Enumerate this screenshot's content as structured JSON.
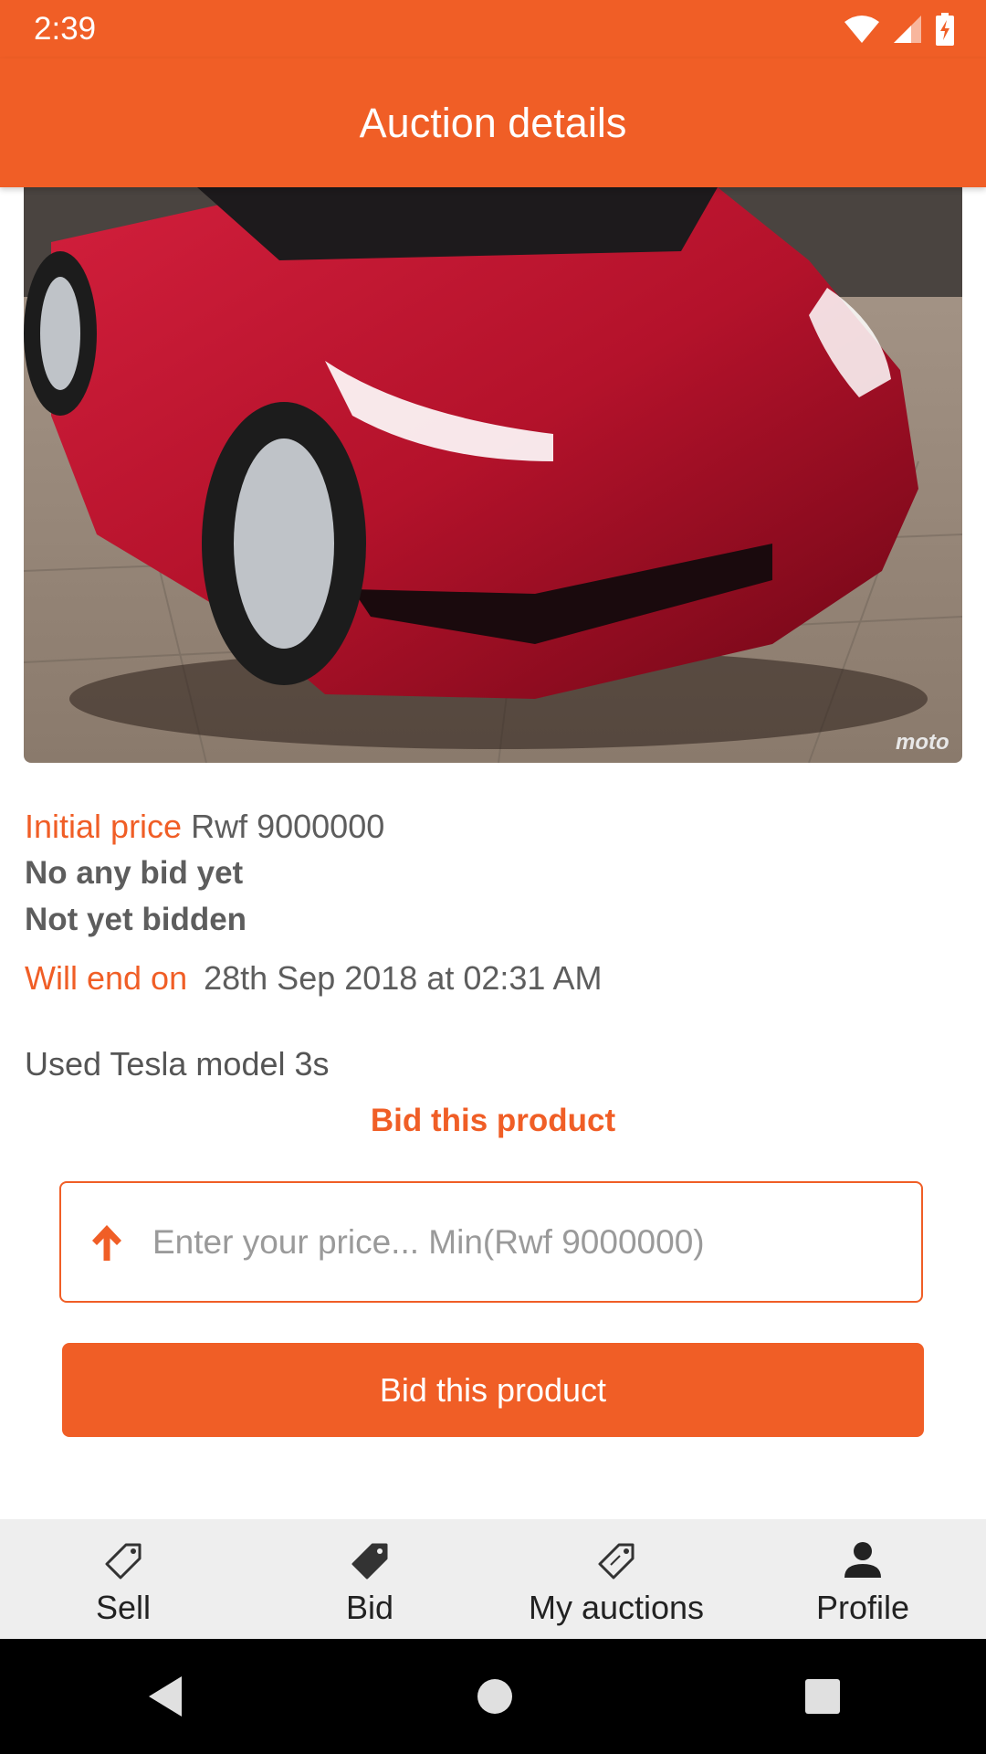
{
  "status_bar": {
    "time": "2:39"
  },
  "app_bar": {
    "title": "Auction details"
  },
  "product": {
    "initial_price_label": "Initial price",
    "initial_price_value": "Rwf 9000000",
    "bid_status": "No any bid yet",
    "bid_status_2": "Not yet bidden",
    "end_label": "Will end on",
    "end_value": "28th Sep 2018 at 02:31 AM",
    "description": "Used Tesla model 3s",
    "image_watermark": "moto"
  },
  "bid": {
    "heading": "Bid this product",
    "input_placeholder": "Enter your price... Min(Rwf 9000000)",
    "input_value": "",
    "button_label": "Bid this product"
  },
  "bottom_nav": {
    "items": [
      {
        "label": "Sell",
        "icon": "tag-outline-icon"
      },
      {
        "label": "Bid",
        "icon": "tag-filled-icon"
      },
      {
        "label": "My auctions",
        "icon": "tag-outline-icon"
      },
      {
        "label": "Profile",
        "icon": "person-icon"
      }
    ]
  },
  "colors": {
    "accent": "#F05E26",
    "nav_background": "#EEEEEE"
  }
}
